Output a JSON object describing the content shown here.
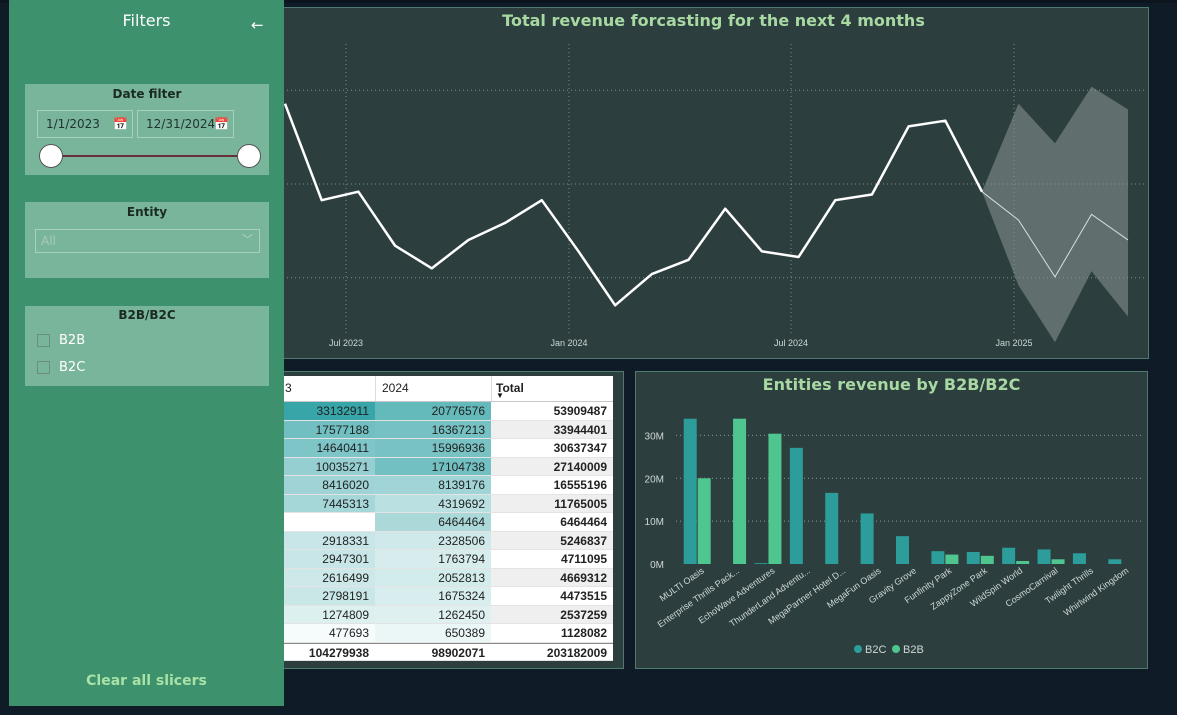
{
  "filters": {
    "title": "Filters",
    "collapse_icon": "←",
    "date_filter": {
      "title": "Date filter",
      "start": "1/1/2023",
      "end": "12/31/2024"
    },
    "entity": {
      "title": "Entity",
      "selected": "All"
    },
    "b2b_b2c": {
      "title": "B2B/B2C",
      "options": [
        "B2B",
        "B2C"
      ]
    },
    "clear_label": "Clear all slicers"
  },
  "forecast": {
    "title": "Total revenue forcasting for the next 4 months",
    "x_ticks": [
      "Jul 2023",
      "Jan 2024",
      "Jul 2024",
      "Jan 2025"
    ]
  },
  "matrix": {
    "headers": [
      "3",
      "2024",
      "Total"
    ],
    "rows": [
      [
        "33132911",
        "20776576",
        "53909487"
      ],
      [
        "17577188",
        "16367213",
        "33944401"
      ],
      [
        "14640411",
        "15996936",
        "30637347"
      ],
      [
        "10035271",
        "17104738",
        "27140009"
      ],
      [
        "8416020",
        "8139176",
        "16555196"
      ],
      [
        "7445313",
        "4319692",
        "11765005"
      ],
      [
        "",
        "6464464",
        "6464464"
      ],
      [
        "2918331",
        "2328506",
        "5246837"
      ],
      [
        "2947301",
        "1763794",
        "4711095"
      ],
      [
        "2616499",
        "2052813",
        "4669312"
      ],
      [
        "2798191",
        "1675324",
        "4473515"
      ],
      [
        "1274809",
        "1262450",
        "2537259"
      ],
      [
        "477693",
        "650389",
        "1128082"
      ]
    ],
    "totals": [
      "104279938",
      "98902071",
      "203182009"
    ]
  },
  "chart_data": [
    {
      "type": "line",
      "title": "Total revenue forcasting for the next 4 months",
      "x_ticks": [
        "Jul 2023",
        "Jan 2024",
        "Jul 2024",
        "Jan 2025"
      ],
      "series": [
        {
          "values": [
            0.79,
            0.45,
            0.48,
            0.29,
            0.21,
            0.31,
            0.37,
            0.45,
            0.27,
            0.08,
            0.19,
            0.24,
            0.42,
            0.27,
            0.25,
            0.45,
            0.47,
            0.71,
            0.73,
            0.48
          ]
        }
      ],
      "forecast": [
        0.48,
        0.38,
        0.18,
        0.4,
        0.31
      ],
      "forecast_upper": [
        0.48,
        0.79,
        0.65,
        0.85,
        0.77
      ],
      "forecast_lower": [
        0.48,
        0.15,
        -0.05,
        0.2,
        0.04
      ]
    },
    {
      "type": "bar",
      "title": "Entities revenue by B2B/B2C",
      "categories": [
        "MULTI Oasis",
        "Enterprise Thrills Pack...",
        "EchoWave Adventures",
        "ThunderLand Adventu...",
        "MegaPartner Hotel D...",
        "MegaFun Oasis",
        "Gravity Grove",
        "Funfinity Park",
        "ZappyZone Park",
        "WildSpin World",
        "CosmoCarnival",
        "Twilight Thrills",
        "Whirlwind Kingdom"
      ],
      "series": [
        {
          "name": "B2C",
          "color": "#2c9d9a",
          "values": [
            33.9,
            0,
            0.2,
            27.1,
            16.6,
            11.8,
            6.5,
            3.0,
            2.8,
            3.8,
            3.4,
            2.5,
            1.1
          ]
        },
        {
          "name": "B2B",
          "color": "#4fc68f",
          "values": [
            20.0,
            33.9,
            30.4,
            0,
            0,
            0,
            0,
            2.2,
            1.9,
            0.7,
            1.1,
            0,
            0
          ]
        }
      ],
      "y_ticks": [
        "0M",
        "10M",
        "20M",
        "30M"
      ],
      "ylim": [
        0,
        35
      ],
      "legend": "bottom-center"
    }
  ]
}
